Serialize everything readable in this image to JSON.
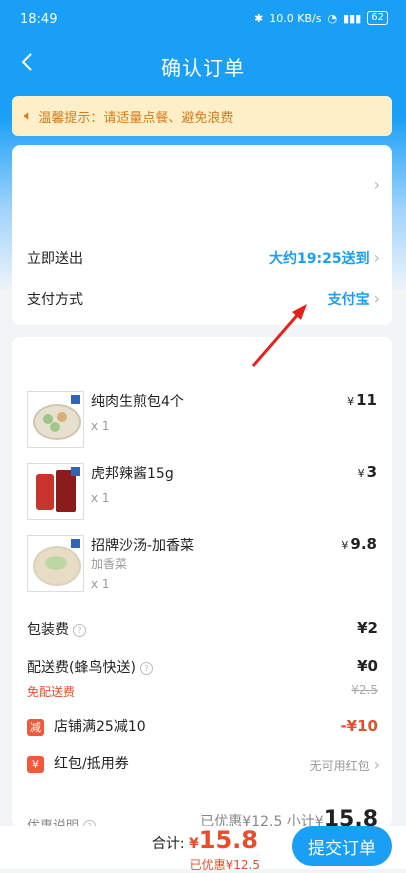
{
  "status": {
    "time": "18:49",
    "network": "10.0 KB/s",
    "battery": "62"
  },
  "nav": {
    "title": "确认订单"
  },
  "notice": {
    "text": "温馨提示：请适量点餐、避免浪费"
  },
  "delivery": {
    "label": "立即送出",
    "eta": "大约19:25送到",
    "payment_label": "支付方式",
    "payment_value": "支付宝"
  },
  "items": [
    {
      "name": "纯肉生煎包4个",
      "spec": "",
      "qty": "x 1",
      "price": "11"
    },
    {
      "name": "虎邦辣酱15g",
      "spec": "",
      "qty": "x 1",
      "price": "3"
    },
    {
      "name": "招牌沙汤-加香菜",
      "spec": "加香菜",
      "qty": "x 1",
      "price": "9.8"
    }
  ],
  "fees": {
    "packing_label": "包装费",
    "packing_value": "¥2",
    "delivery_label": "配送费(蜂鸟快送)",
    "delivery_value": "¥0",
    "free_delivery": "免配送费",
    "original_delivery": "¥2.5"
  },
  "discount": {
    "badge": "减",
    "label": "店铺满25减10",
    "value": "-¥10"
  },
  "redpacket": {
    "badge": "¥",
    "label": "红包/抵用券",
    "value": "无可用红包"
  },
  "summary_partial": {
    "left": "优惠说明",
    "right": "已优惠¥12.5  小计¥",
    "total": "15.8"
  },
  "footer": {
    "total_label": "合计: ",
    "currency": "¥",
    "total": "15.8",
    "saved": "已优惠¥12.5",
    "submit": "提交订单"
  },
  "colors": {
    "primary": "#1a9ff6",
    "accent": "#e84d2e",
    "notice_bg": "#fdefc8"
  }
}
